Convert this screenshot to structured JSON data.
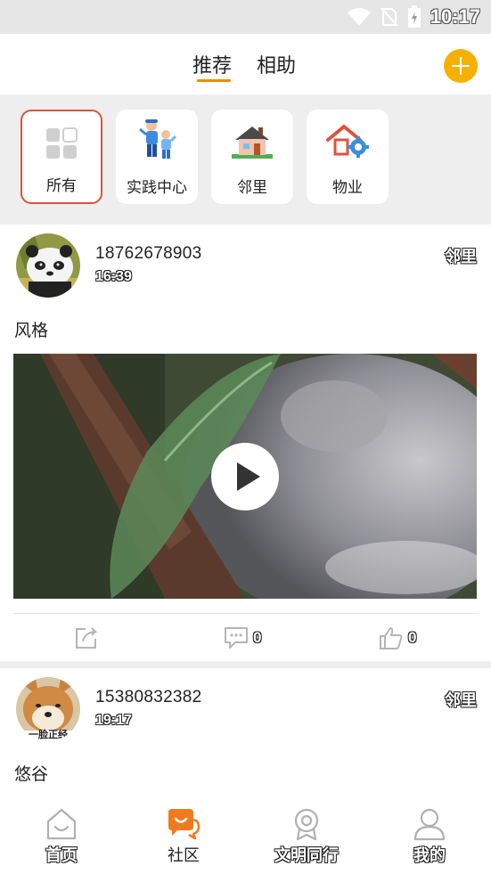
{
  "status_bar": {
    "time": "10:17",
    "icons": [
      "wifi-icon",
      "no-sim-icon",
      "battery-icon"
    ]
  },
  "header": {
    "tabs": [
      {
        "label": "推荐",
        "active": true
      },
      {
        "label": "相助",
        "active": false
      }
    ],
    "add_icon": "plus-icon",
    "accent_color": "#f08a00"
  },
  "categories": [
    {
      "label": "所有",
      "icon": "grid-icon",
      "active": true
    },
    {
      "label": "实践中心",
      "icon": "volunteers-icon",
      "active": false
    },
    {
      "label": "邻里",
      "icon": "house-icon",
      "active": false
    },
    {
      "label": "物业",
      "icon": "house-gear-icon",
      "active": false
    }
  ],
  "posts": [
    {
      "username": "18762678903",
      "time": "16:39",
      "tag": "邻里",
      "content": "风格",
      "has_video": true,
      "actions": {
        "share_icon": "share-icon",
        "comment_count": "0",
        "like_count": "0"
      }
    },
    {
      "username": "15380832382",
      "time": "19:17",
      "tag": "邻里",
      "content": "悠谷",
      "avatar_caption": "一脸正经"
    }
  ],
  "bottom_nav": [
    {
      "label": "首页",
      "icon": "home-icon",
      "active": false
    },
    {
      "label": "社区",
      "icon": "community-chat-icon",
      "active": true
    },
    {
      "label": "文明同行",
      "icon": "civilization-medal-icon",
      "active": false
    },
    {
      "label": "我的",
      "icon": "profile-icon",
      "active": false
    }
  ]
}
